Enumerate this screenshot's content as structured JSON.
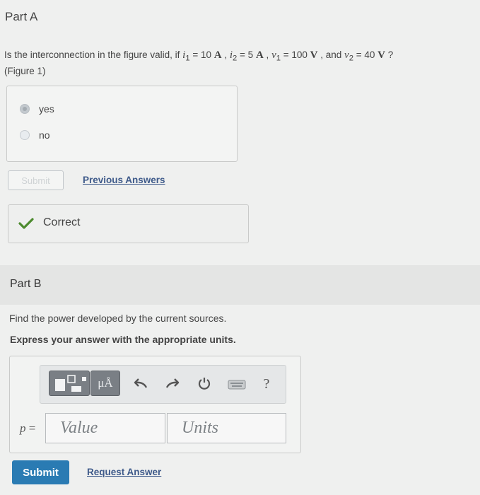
{
  "part_a": {
    "title": "Part A",
    "question": {
      "prefix": "Is the interconnection in the figure valid, if ",
      "i1_sym": "i",
      "i1_sub": "1",
      "i1_eq": " = 10 ",
      "i1_unit": "A",
      "sep1": " , ",
      "i2_sym": "i",
      "i2_sub": "2",
      "i2_eq": " = 5 ",
      "i2_unit": "A",
      "sep2": " , ",
      "v1_sym": "v",
      "v1_sub": "1",
      "v1_eq": " = 100 ",
      "v1_unit": "V",
      "sep3": " , and ",
      "v2_sym": "v",
      "v2_sub": "2",
      "v2_eq": " = 40 ",
      "v2_unit": "V",
      "suffix": " ?",
      "figure_ref": "(Figure 1)"
    },
    "choices": [
      {
        "label": "yes",
        "selected": true
      },
      {
        "label": "no",
        "selected": false
      }
    ],
    "submit_label": "Submit",
    "previous_answers_label": "Previous Answers",
    "feedback": "Correct"
  },
  "part_b": {
    "title": "Part B",
    "prompt": "Find the power developed by the current sources.",
    "instruction": "Express your answer with the appropriate units.",
    "toolbar": {
      "units_button": "μÅ",
      "help": "?"
    },
    "variable_label": "p",
    "equals": " =",
    "value_placeholder": "Value",
    "units_placeholder": "Units",
    "submit_label": "Submit",
    "request_answer_label": "Request Answer"
  },
  "colors": {
    "accent_blue": "#2a7bb3",
    "link": "#3e5a8a",
    "correct_green": "#4c8a2e",
    "toolbar_gray": "#7a7f85"
  }
}
